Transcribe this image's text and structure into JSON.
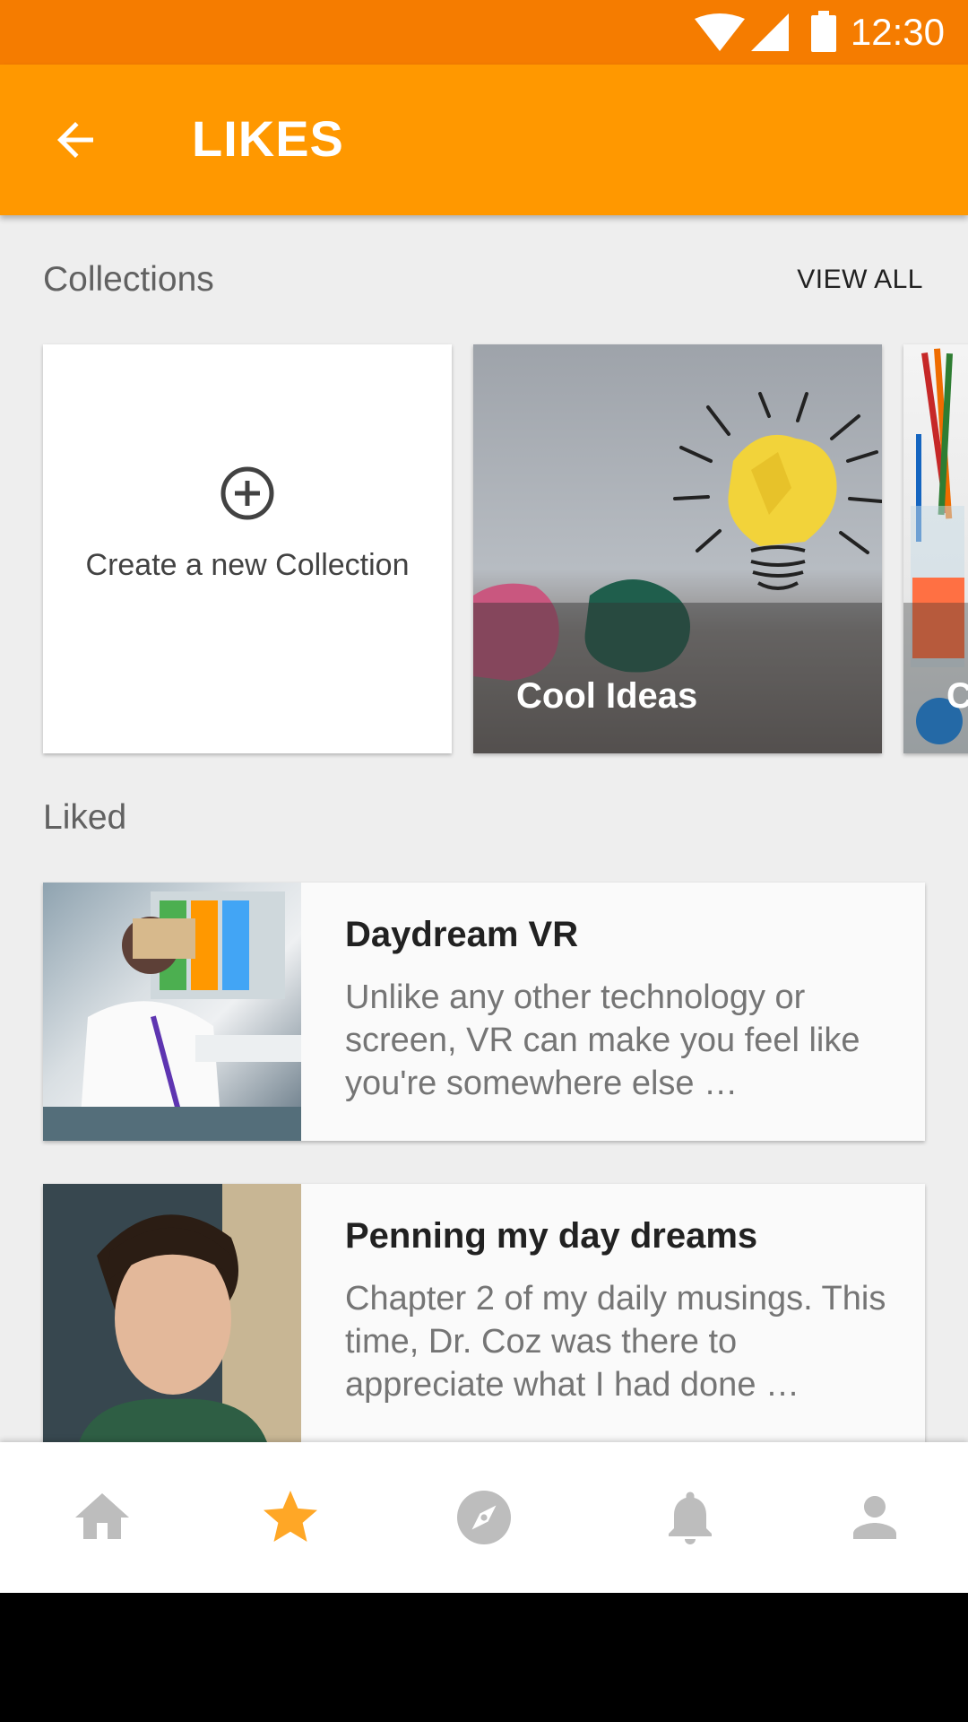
{
  "status_bar": {
    "time": "12:30"
  },
  "app_bar": {
    "title": "LIKES"
  },
  "collections": {
    "header": "Collections",
    "view_all_label": "VIEW ALL",
    "create_label": "Create a new Collection",
    "items": [
      {
        "name": "Cool Ideas"
      },
      {
        "name": "C"
      }
    ]
  },
  "liked": {
    "header": "Liked",
    "items": [
      {
        "title": "Daydream VR",
        "description": "Unlike any other technology or screen, VR can make you feel like you're somewhere else …"
      },
      {
        "title": "Penning my day dreams",
        "description": "Chapter 2 of my daily musings. This time, Dr. Coz was there to appreciate what I had done …"
      }
    ]
  },
  "bottom_nav": {
    "items": [
      {
        "icon": "home-icon",
        "active": false
      },
      {
        "icon": "star-icon",
        "active": true
      },
      {
        "icon": "compass-icon",
        "active": false
      },
      {
        "icon": "bell-icon",
        "active": false
      },
      {
        "icon": "person-icon",
        "active": false
      }
    ],
    "active_color": "#ffa726",
    "inactive_color": "#bdbdbd"
  },
  "colors": {
    "status_bar": "#f57c00",
    "app_bar": "#ff9800"
  }
}
